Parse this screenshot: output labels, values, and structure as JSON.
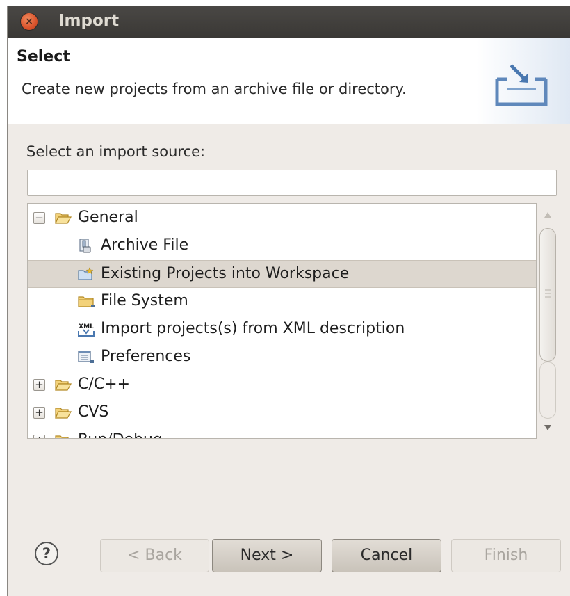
{
  "window": {
    "title": "Import"
  },
  "header": {
    "title": "Select",
    "description": "Create new projects from an archive file or directory."
  },
  "source": {
    "label": "Select an import source:",
    "filter_value": ""
  },
  "tree": {
    "items": [
      {
        "label": "General",
        "icon": "folder-open-icon",
        "expander": "−",
        "expanded": true,
        "level": 0
      },
      {
        "label": "Archive File",
        "icon": "archive-file-icon",
        "level": 1
      },
      {
        "label": "Existing Projects into Workspace",
        "icon": "existing-projects-icon",
        "level": 1,
        "selected": true
      },
      {
        "label": "File System",
        "icon": "folder-icon",
        "level": 1
      },
      {
        "label": "Import projects(s) from XML description",
        "icon": "xml-icon",
        "icon_text": "XML",
        "level": 1
      },
      {
        "label": "Preferences",
        "icon": "preferences-icon",
        "level": 1
      },
      {
        "label": "C/C++",
        "icon": "folder-closed-icon",
        "expander": "+",
        "level": 0
      },
      {
        "label": "CVS",
        "icon": "folder-closed-icon",
        "expander": "+",
        "level": 0
      },
      {
        "label": "Run/Debug",
        "icon": "folder-closed-icon",
        "expander": "+",
        "level": 0,
        "partially_visible": true
      }
    ]
  },
  "buttons": {
    "help": "?",
    "back": "< Back",
    "next": "Next >",
    "cancel": "Cancel",
    "finish": "Finish"
  },
  "colors": {
    "titlebar": "#3f3d3a",
    "close_button": "#d9532c",
    "dialog_background": "#efebe7",
    "selection": "#ddd7cf"
  }
}
